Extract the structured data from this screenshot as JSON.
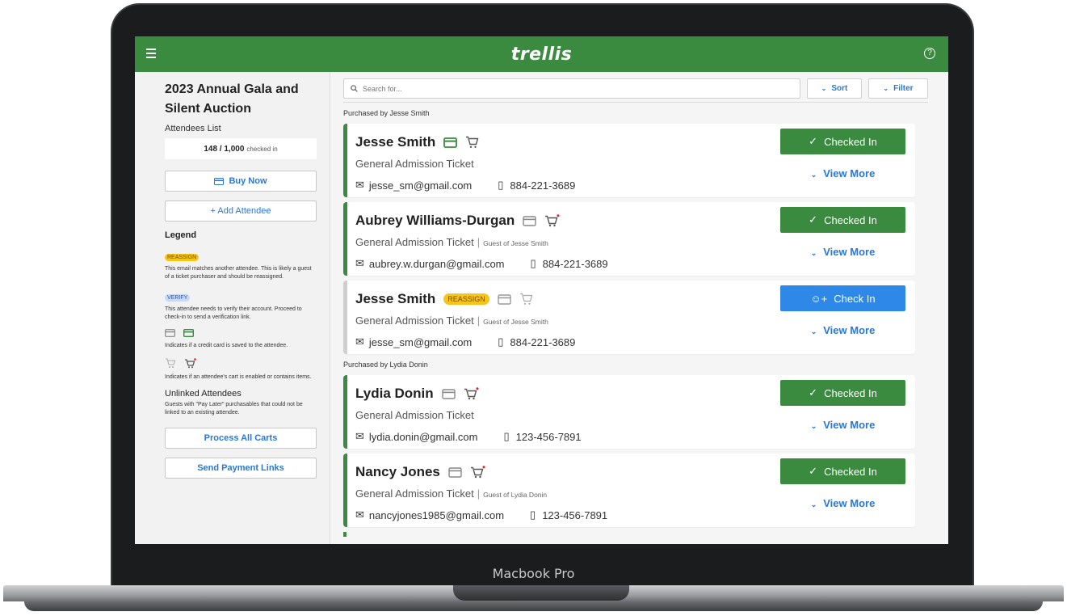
{
  "device": {
    "label": "Macbook Pro"
  },
  "app": {
    "logo": "trellis"
  },
  "sidebar": {
    "event_title_line1": "2023 Annual Gala and",
    "event_title_line2": "Silent Auction",
    "attendees_list_label": "Attendees List",
    "checked_count": "148 / 1,000",
    "checked_suffix": "checked in",
    "buy_now_label": "Buy Now",
    "add_attendee_label": "+ Add Attendee",
    "legend_title": "Legend",
    "legend": {
      "reassign_badge": "REASSIGN",
      "reassign_text": "This email matches another attendee. This is likely a guest of a ticket purchaser and should be reassigned.",
      "verify_badge": "VERIFY",
      "verify_text": "This attendee needs to verify their account. Proceed to check-in to send a verification link.",
      "card_text": "Indicates if a credit card is saved to the attendee.",
      "cart_text": "Indicates if an attendee's cart is enabled or contains items."
    },
    "unlinked_title": "Unlinked Attendees",
    "unlinked_text": "Guests with \"Pay Later\" purchasables that could not be linked to an existing attendee.",
    "process_carts_label": "Process All Carts",
    "send_links_label": "Send Payment Links"
  },
  "toolbar": {
    "search_placeholder": "Search for...",
    "sort_label": "Sort",
    "filter_label": "Filter"
  },
  "groups": [
    {
      "label": "Purchased by Jesse Smith",
      "attendees": [
        {
          "name": "Jesse Smith",
          "ticket": "General Admission Ticket",
          "guest_of": "",
          "email": "jesse_sm@gmail.com",
          "phone": "884-221-3689",
          "status": "Checked In",
          "view_more": "View More"
        },
        {
          "name": "Aubrey Williams-Durgan",
          "ticket": "General Admission Ticket",
          "guest_of": "Guest of Jesse Smith",
          "email": "aubrey.w.durgan@gmail.com",
          "phone": "884-221-3689",
          "status": "Checked In",
          "view_more": "View More"
        },
        {
          "name": "Jesse Smith",
          "badge": "REASSIGN",
          "ticket": "General Admission Ticket",
          "guest_of": "Guest of Jesse Smith",
          "email": "jesse_sm@gmail.com",
          "phone": "884-221-3689",
          "status": "Check In",
          "view_more": "View More"
        }
      ]
    },
    {
      "label": "Purchased by Lydia Donin",
      "attendees": [
        {
          "name": "Lydia Donin",
          "ticket": "General Admission Ticket",
          "guest_of": "",
          "email": "lydia.donin@gmail.com",
          "phone": "123-456-7891",
          "status": "Checked In",
          "view_more": "View More"
        },
        {
          "name": "Nancy Jones",
          "ticket": "General Admission Ticket",
          "guest_of": "Guest of Lydia Donin",
          "email": "nancyjones1985@gmail.com",
          "phone": "123-456-7891",
          "status": "Checked In",
          "view_more": "View More"
        }
      ]
    }
  ],
  "colors": {
    "brand_green": "#3a8a3f",
    "action_blue": "#2d88e8",
    "link_blue": "#2a78d4",
    "reassign_yellow": "#f5c518",
    "cart_dot_red": "#e02020"
  }
}
